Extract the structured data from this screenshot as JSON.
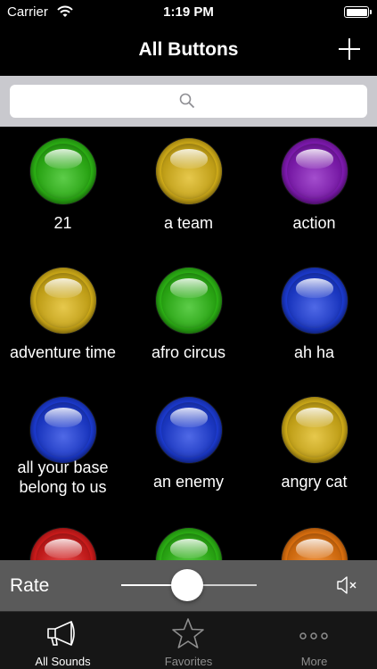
{
  "status_bar": {
    "carrier": "Carrier",
    "time": "1:19 PM"
  },
  "nav": {
    "title": "All Buttons",
    "add_icon": "plus-icon"
  },
  "search": {
    "placeholder": "",
    "icon": "search-icon"
  },
  "sounds": [
    {
      "label": "21",
      "color": "#2fbf16"
    },
    {
      "label": "a team",
      "color": "#e0b91a"
    },
    {
      "label": "action",
      "color": "#8a1cc0"
    },
    {
      "label": "adventure time",
      "color": "#e0b91a"
    },
    {
      "label": "afro circus",
      "color": "#2fbf16"
    },
    {
      "label": "ah ha",
      "color": "#1e3fe0"
    },
    {
      "label": "all your base belong to us",
      "color": "#1e3fe0"
    },
    {
      "label": "an enemy",
      "color": "#1e3fe0"
    },
    {
      "label": "angry cat",
      "color": "#e0b91a"
    },
    {
      "label": "",
      "color": "#e01e1e"
    },
    {
      "label": "",
      "color": "#2fbf16"
    },
    {
      "label": "",
      "color": "#f07a10"
    }
  ],
  "rate": {
    "label": "Rate",
    "value": 0.48,
    "mute_icon": "speaker-muted-icon"
  },
  "tabs": [
    {
      "label": "All Sounds",
      "icon": "megaphone-icon",
      "active": true
    },
    {
      "label": "Favorites",
      "icon": "star-icon",
      "active": false
    },
    {
      "label": "More",
      "icon": "more-dots-icon",
      "active": false
    }
  ]
}
